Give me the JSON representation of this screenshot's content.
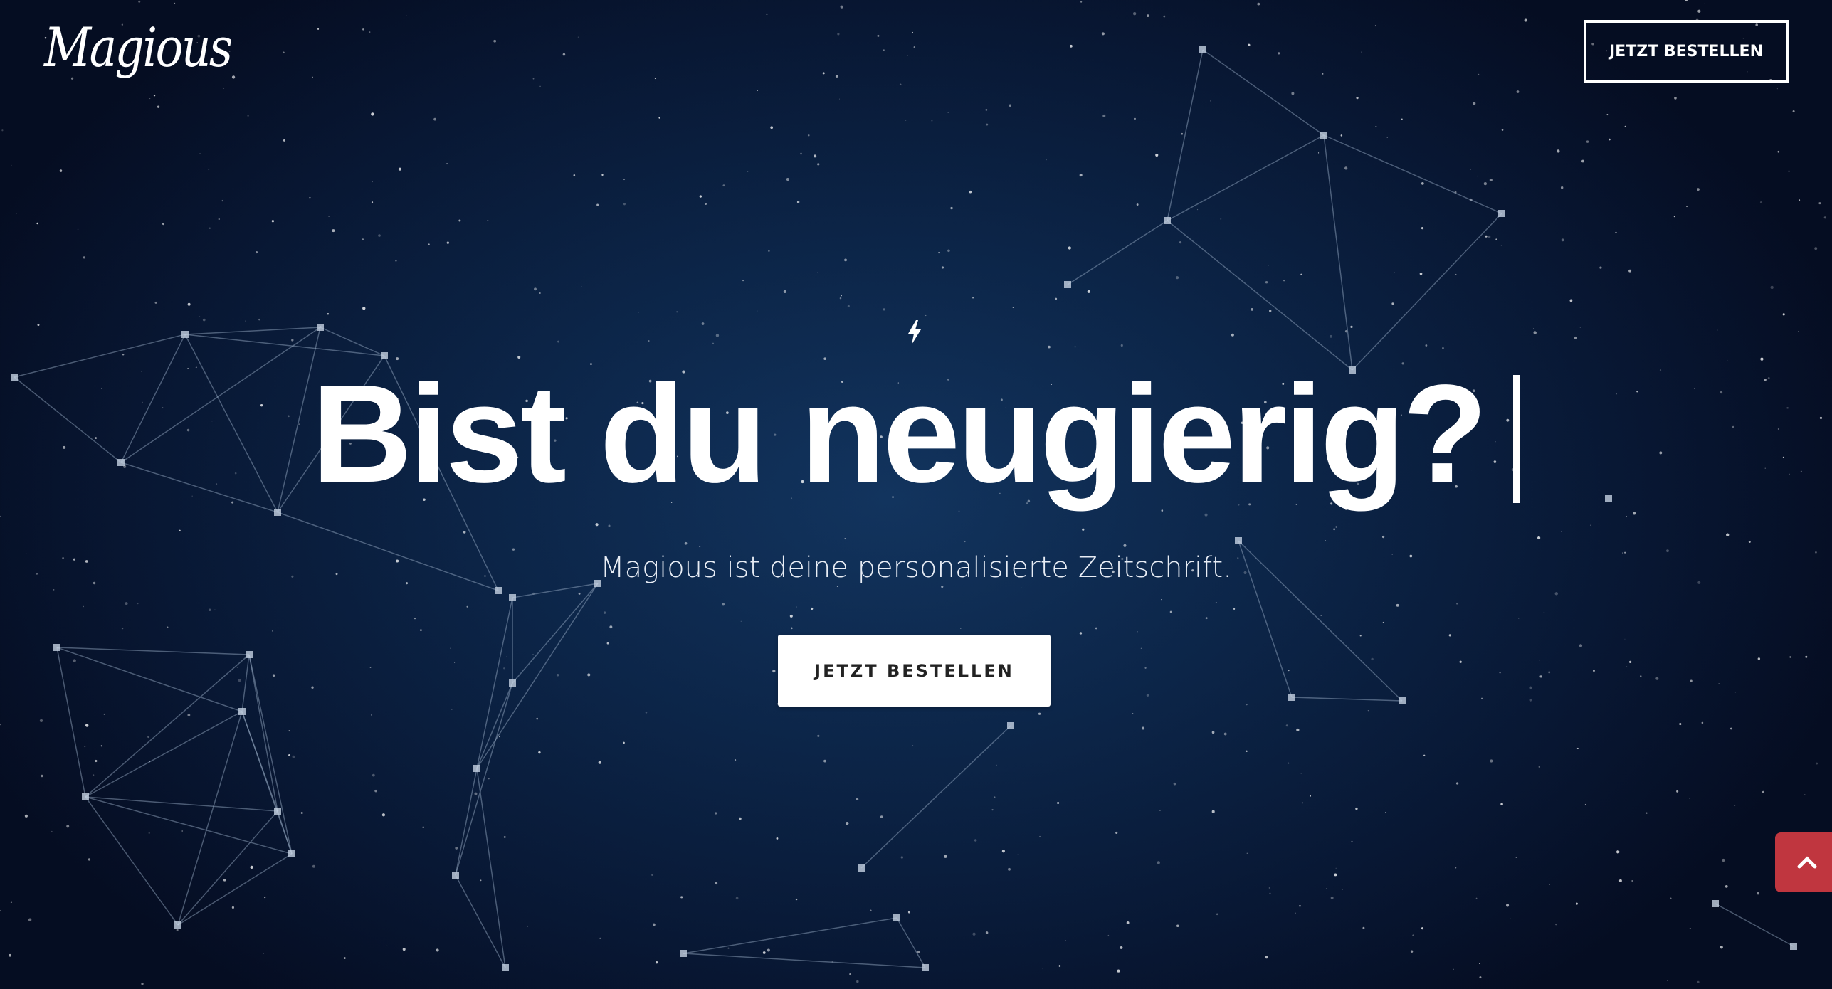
{
  "header": {
    "logo_text": "Magious",
    "order_button_label": "JETZT BESTELLEN"
  },
  "hero": {
    "icon": "lightning-bolt-icon",
    "headline": "Bist du neugierig?",
    "subtitle": "Magious ist deine personalisierte Zeitschrift.",
    "cta_label": "JETZT BESTELLEN"
  },
  "scroll_top": {
    "icon": "chevron-up-icon",
    "color": "#c0363f"
  },
  "colors": {
    "background": "#0c2548",
    "cta_background": "#ffffff"
  }
}
